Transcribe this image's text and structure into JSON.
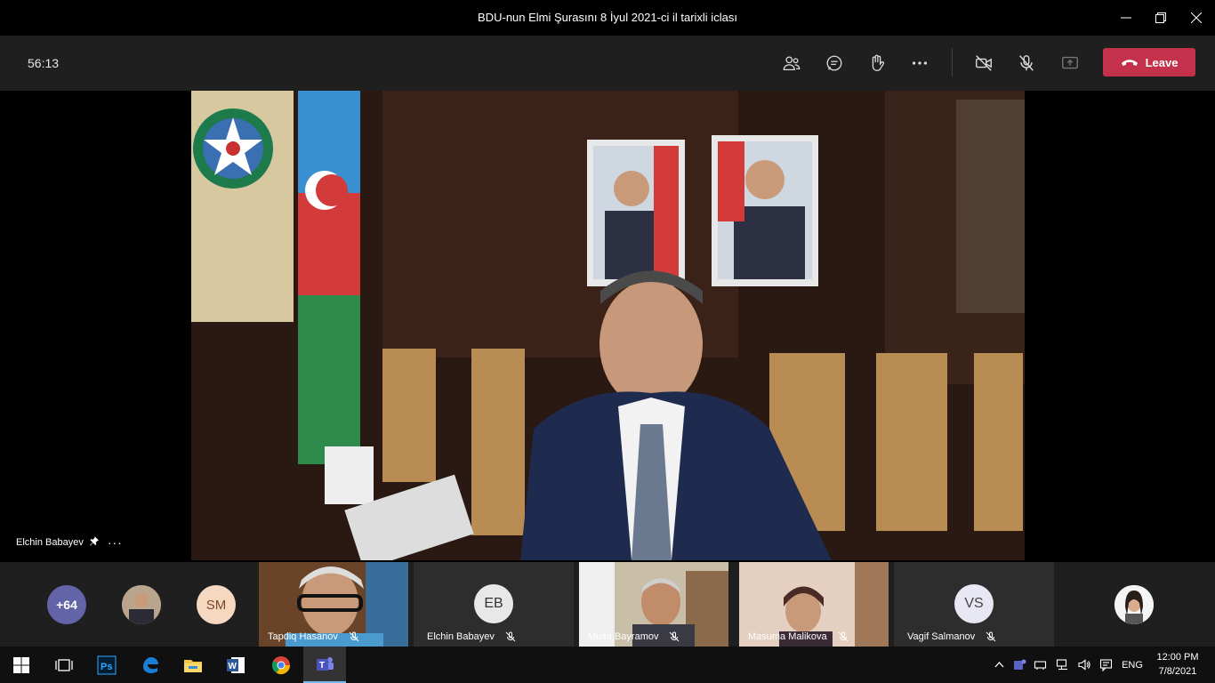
{
  "window": {
    "title": "BDU-nun Elmi Şurasını 8 İyul 2021-ci il tarixli iclası"
  },
  "toolbar": {
    "timer": "56:13",
    "leave_label": "Leave",
    "icons": [
      "participants-icon",
      "chat-icon",
      "raise-hand-icon",
      "more-icon",
      "camera-off-icon",
      "mic-off-icon",
      "share-icon"
    ]
  },
  "stage": {
    "speaker_name": "Elchin Babayev"
  },
  "participants_strip": {
    "overflow_count": "+64",
    "bubbles": [
      {
        "initials": "SM"
      }
    ],
    "tiles": [
      {
        "name": "Tapdiq Hasanov"
      },
      {
        "name": "Elchin Babayev",
        "initials": "EB"
      },
      {
        "name": "Musa Bayramov"
      },
      {
        "name": "Masuma Malikova"
      },
      {
        "name": "Vagif Salmanov",
        "initials": "VS"
      }
    ]
  },
  "taskbar": {
    "language": "ENG",
    "time": "12:00 PM",
    "date": "7/8/2021",
    "apps": [
      "start-icon",
      "task-view-icon",
      "photoshop-icon",
      "edge-icon",
      "file-explorer-icon",
      "word-icon",
      "chrome-icon",
      "teams-icon"
    ]
  },
  "colors": {
    "leave": "#c4314b",
    "toolbar_bg": "#1f1f1f",
    "overflow_bubble": "#6264a7",
    "sm_bubble": "#f6d7c0",
    "avatar_bg": "#e8e8e8"
  }
}
